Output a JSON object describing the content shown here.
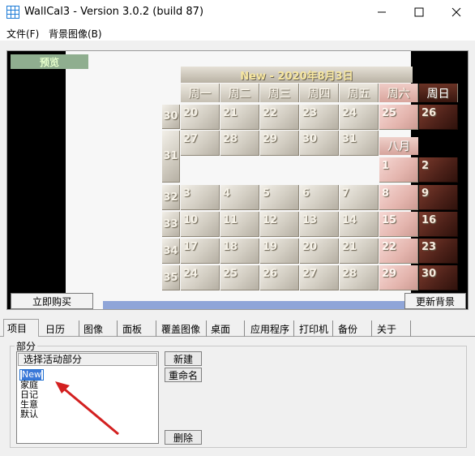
{
  "window": {
    "title": "WallCal3 - Version 3.0.2 (build 87)",
    "icon": "calendar-grid-icon",
    "controls": {
      "minimize": "minimize-icon",
      "maximize": "maximize-icon",
      "close": "close-icon"
    }
  },
  "menu": {
    "items": [
      "文件(F)",
      "背景图像(B)"
    ]
  },
  "preview": {
    "label": "预览",
    "title": "New - 2020年8月3日",
    "month_label": "八月",
    "weekdays": [
      "周一",
      "周二",
      "周三",
      "周四",
      "周五",
      "周六",
      "周日"
    ],
    "week_numbers": [
      "30",
      "31",
      "32",
      "33",
      "34",
      "35"
    ],
    "july": [
      [
        "20",
        "21",
        "22",
        "23",
        "24",
        "25",
        "26"
      ],
      [
        "27",
        "28",
        "29",
        "30",
        "31"
      ]
    ],
    "august_first_row": [
      "1",
      "2"
    ],
    "august": [
      [
        "3",
        "4",
        "5",
        "6",
        "7",
        "8",
        "9"
      ],
      [
        "10",
        "11",
        "12",
        "13",
        "14",
        "15",
        "16"
      ],
      [
        "17",
        "18",
        "19",
        "20",
        "21",
        "22",
        "23"
      ],
      [
        "24",
        "25",
        "26",
        "27",
        "28",
        "29",
        "30"
      ]
    ],
    "buy_button": "立即购买",
    "refresh_button": "更新背景",
    "colors": {
      "weekday": "#d3cec3",
      "saturday": "#e4b5ae",
      "sunday": "#4b2018",
      "title_text": "#f6e6a0"
    }
  },
  "tabs": [
    "项目",
    "日历",
    "图像",
    "面板",
    "覆盖图像",
    "桌面",
    "应用程序",
    "打印机",
    "备份",
    "关于"
  ],
  "active_tab": "项目",
  "parts": {
    "group_title": "部分",
    "list_header": "选择活动部分",
    "items": [
      "New",
      "家庭",
      "日记",
      "生意",
      "默认"
    ],
    "selected": "New",
    "buttons": {
      "new": "新建",
      "rename": "重命名",
      "delete": "删除"
    }
  }
}
